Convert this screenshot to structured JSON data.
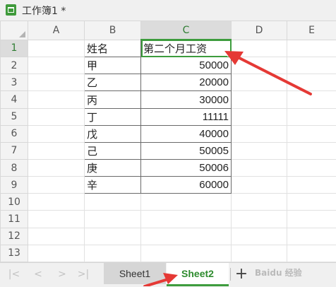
{
  "window": {
    "title": "工作簿1 *"
  },
  "columns": [
    "A",
    "B",
    "C",
    "D",
    "E"
  ],
  "rows": [
    "1",
    "2",
    "3",
    "4",
    "5",
    "6",
    "7",
    "8",
    "9",
    "10",
    "11",
    "12",
    "13"
  ],
  "table": {
    "header_name": "姓名",
    "header_value": "第二个月工资",
    "records": [
      {
        "name": "甲",
        "value": "50000"
      },
      {
        "name": "乙",
        "value": "20000"
      },
      {
        "name": "丙",
        "value": "30000"
      },
      {
        "name": "丁",
        "value": "11111"
      },
      {
        "name": "戊",
        "value": "40000"
      },
      {
        "name": "己",
        "value": "50005"
      },
      {
        "name": "庚",
        "value": "50006"
      },
      {
        "name": "辛",
        "value": "60000"
      }
    ]
  },
  "selection": {
    "column": "C",
    "row": "1"
  },
  "sheet_tabs": [
    {
      "label": "Sheet1",
      "active": false
    },
    {
      "label": "Sheet2",
      "active": true
    }
  ],
  "add_sheet": "+",
  "nav": {
    "first": "|<",
    "prev": "<",
    "next": ">",
    "last": ">|"
  },
  "watermark": "Baidu 经验",
  "colors": {
    "accent": "#3d9c3d",
    "arrow": "#e53935"
  }
}
